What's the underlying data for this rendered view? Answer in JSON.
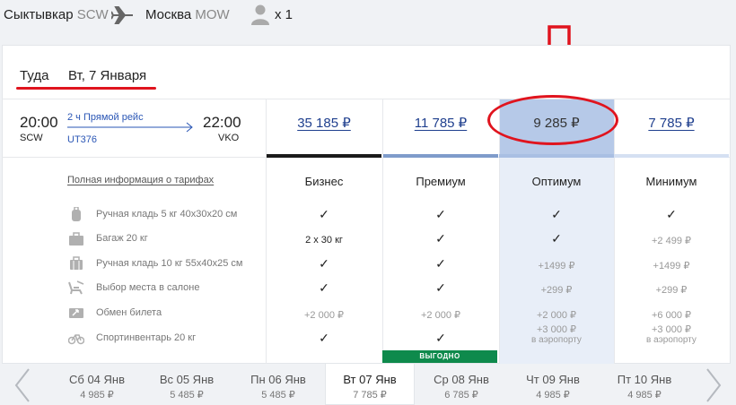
{
  "route": {
    "from_city": "Сыктывкар",
    "from_code": "SCW",
    "to_city": "Москва",
    "to_code": "MOW",
    "passengers": "x 1"
  },
  "direction": {
    "label": "Туда",
    "date": "Вт, 7 Января"
  },
  "flight": {
    "dep_time": "20:00",
    "dep_code": "SCW",
    "arr_time": "22:00",
    "arr_code": "VKO",
    "duration": "2 ч Прямой рейс",
    "flight_no": "UT376"
  },
  "fares": [
    {
      "name": "Бизнес",
      "price": "35 185 ₽"
    },
    {
      "name": "Премиум",
      "price": "11 785 ₽"
    },
    {
      "name": "Оптимум",
      "price": "9 285 ₽"
    },
    {
      "name": "Минимум",
      "price": "7 785 ₽"
    }
  ],
  "full_info_link": "Полная информация о тарифах",
  "features": [
    {
      "label": "Ручная кладь 5 кг 40x30x20 см",
      "icon": "backpack-icon",
      "values": [
        "✓",
        "✓",
        "✓",
        "✓"
      ]
    },
    {
      "label": "Багаж 20 кг",
      "icon": "baggage-icon",
      "values": [
        "2 x 30 кг",
        "✓",
        "✓",
        "+2 499 ₽"
      ]
    },
    {
      "label": "Ручная кладь 10 кг 55x40x25 см",
      "icon": "suitcase-icon",
      "values": [
        "✓",
        "✓",
        "+1499 ₽",
        "+1499 ₽"
      ]
    },
    {
      "label": "Выбор места в салоне",
      "icon": "seat-icon",
      "values": [
        "✓",
        "✓",
        "+299 ₽",
        "+299 ₽"
      ]
    },
    {
      "label": "Обмен билета",
      "icon": "exchange-icon",
      "values": [
        "+2 000 ₽",
        "+2 000 ₽",
        "+2 000 ₽",
        "+6 000 ₽"
      ]
    },
    {
      "label": "Спортинвентарь 20 кг",
      "icon": "bicycle-icon",
      "values": [
        "✓",
        "✓",
        "+3 000 ₽",
        "+3 000 ₽"
      ],
      "notes": [
        "",
        "",
        "в аэропорту",
        "в аэропорту"
      ]
    }
  ],
  "badge": "ВЫГОДНО",
  "dates": [
    {
      "label": "Сб 04 Янв",
      "price": "4 985 ₽"
    },
    {
      "label": "Вс 05 Янв",
      "price": "5 485 ₽"
    },
    {
      "label": "Пн 06 Янв",
      "price": "5 485 ₽"
    },
    {
      "label": "Вт 07 Янв",
      "price": "7 785 ₽"
    },
    {
      "label": "Ср 08 Янв",
      "price": "6 785 ₽"
    },
    {
      "label": "Чт 09 Янв",
      "price": "4 985 ₽"
    },
    {
      "label": "Пт 10 Янв",
      "price": "4 985 ₽"
    }
  ],
  "colors": {
    "accent_red": "#e0141e",
    "link_blue": "#1f3f8e",
    "selected_column": "#b6c9e8",
    "badge_green": "#0e8a4c"
  }
}
